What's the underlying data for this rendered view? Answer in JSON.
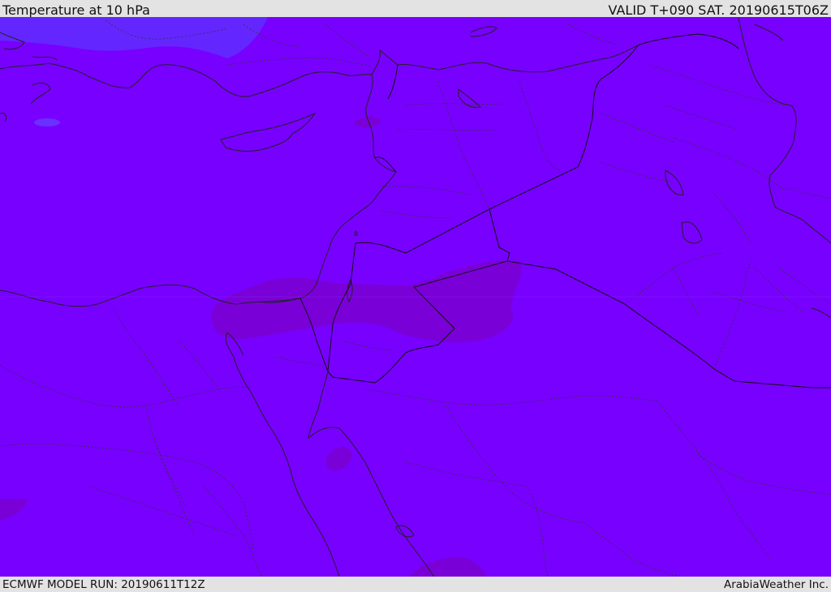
{
  "header": {
    "title": "Temperature at 10 hPa",
    "valid": "VALID T+090 SAT. 20190615T06Z"
  },
  "footer": {
    "model_run": "ECMWF MODEL RUN: 20190611T12Z",
    "credit": "ArabiaWeather Inc."
  },
  "map": {
    "field": "Temperature at 10 hPa",
    "colors": {
      "base": "#7800ff",
      "cold_region": "#6426ff",
      "warm_region": "#7a00d8"
    }
  }
}
